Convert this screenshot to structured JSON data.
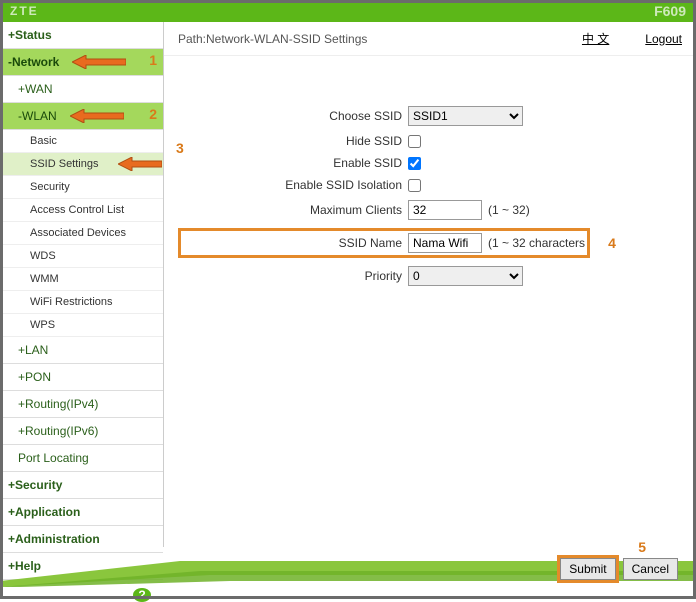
{
  "topbar": {
    "logo_partial": "ZTE",
    "model_partial": "F609"
  },
  "header": {
    "path": "Path:Network-WLAN-SSID Settings",
    "lang": "中 文",
    "logout": "Logout"
  },
  "sidebar": {
    "status": "+Status",
    "network": "-Network",
    "wan": "+WAN",
    "wlan": "-WLAN",
    "wlan_children": {
      "basic": "Basic",
      "ssid_settings": "SSID Settings",
      "security": "Security",
      "acl": "Access Control List",
      "assoc": "Associated Devices",
      "wds": "WDS",
      "wmm": "WMM",
      "wifi_restrict": "WiFi Restrictions",
      "wps": "WPS"
    },
    "lan": "+LAN",
    "pon": "+PON",
    "routing4": "+Routing(IPv4)",
    "routing6": "+Routing(IPv6)",
    "port_locating": "Port Locating",
    "security": "+Security",
    "application": "+Application",
    "administration": "+Administration",
    "help": "+Help"
  },
  "form": {
    "choose_ssid": {
      "label": "Choose SSID",
      "value": "SSID1"
    },
    "hide_ssid": {
      "label": "Hide SSID",
      "checked": false
    },
    "enable_ssid": {
      "label": "Enable SSID",
      "checked": true
    },
    "enable_isolation": {
      "label": "Enable SSID Isolation",
      "checked": false
    },
    "max_clients": {
      "label": "Maximum Clients",
      "value": "32",
      "hint": "(1 ~ 32)"
    },
    "ssid_name": {
      "label": "SSID Name",
      "value": "Nama Wifi",
      "hint": "(1 ~ 32 characters"
    },
    "priority": {
      "label": "Priority",
      "value": "0"
    }
  },
  "buttons": {
    "submit": "Submit",
    "cancel": "Cancel"
  },
  "annotations": {
    "n1": "1",
    "n2": "2",
    "n3": "3",
    "n4": "4",
    "n5": "5"
  },
  "help_icon": "?"
}
